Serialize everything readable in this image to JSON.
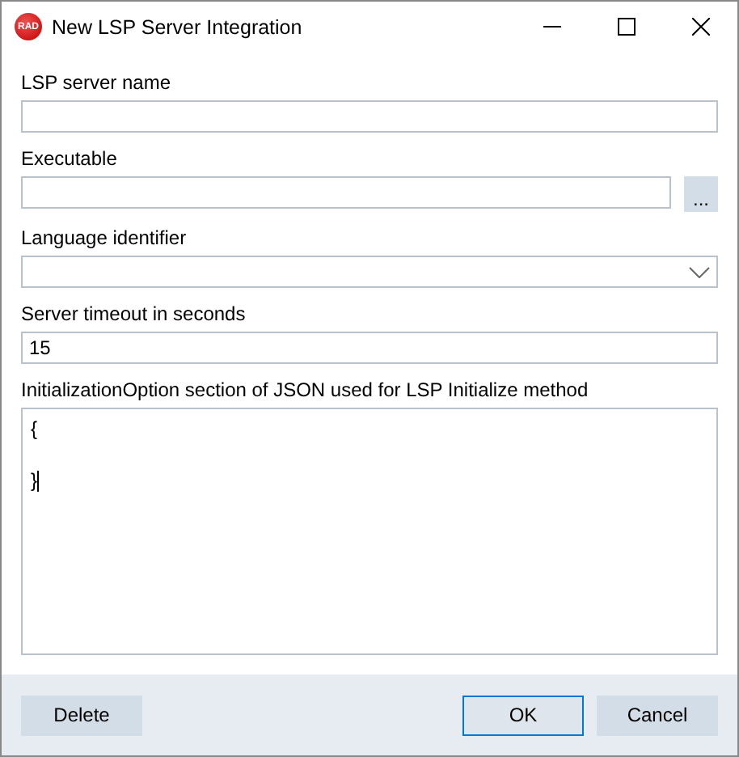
{
  "window": {
    "title": "New LSP Server Integration",
    "logo": "RAD"
  },
  "fields": [
    {
      "kind": "text",
      "label": "LSP server name"
    },
    {
      "kind": "browse",
      "label": "Executable",
      "button": "..."
    },
    {
      "kind": "combo",
      "label": "Language identifier"
    },
    {
      "kind": "text",
      "label": "Server timeout in seconds",
      "value": "15"
    },
    {
      "kind": "textarea",
      "label": "InitializationOption section of JSON used for LSP Initialize method",
      "text": "{\n\n}"
    }
  ],
  "footer_left": [
    {
      "label": "Delete",
      "default": false
    }
  ],
  "footer_right": [
    {
      "label": "OK",
      "default": true
    },
    {
      "label": "Cancel",
      "default": false
    }
  ]
}
